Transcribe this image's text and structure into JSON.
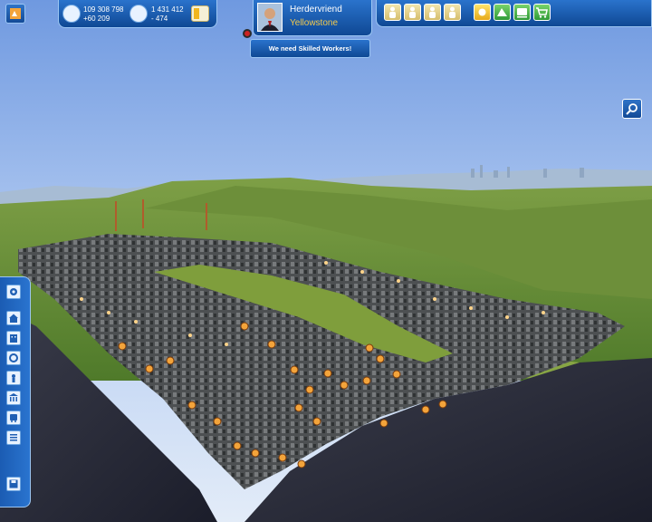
{
  "finance": {
    "money": "109 308 798",
    "money_delta": "+60 209"
  },
  "population": {
    "count": "1 431 412",
    "delta": "- 474"
  },
  "mayor": {
    "name": "Herdervriend",
    "city": "Yellowstone"
  },
  "notification": "We need Skilled Workers!",
  "demand_buttons": [
    "worker-icon",
    "worker-icon",
    "worker-icon",
    "worker-icon"
  ],
  "toolbar_buttons": [
    "sun-icon",
    "road-money-icon",
    "train-icon",
    "cart-icon"
  ],
  "left_menu_icons": [
    "gear-icon",
    "house-icon",
    "office-icon",
    "recycle-icon",
    "leisure-icon",
    "public-building-icon",
    "transport-icon",
    "list-icon",
    "save-icon"
  ],
  "colors": {
    "hud_blue": "#1f5fb3",
    "hud_border": "#9cc6f3",
    "city_name": "#f2c94c",
    "marker": "#f3a43b"
  }
}
